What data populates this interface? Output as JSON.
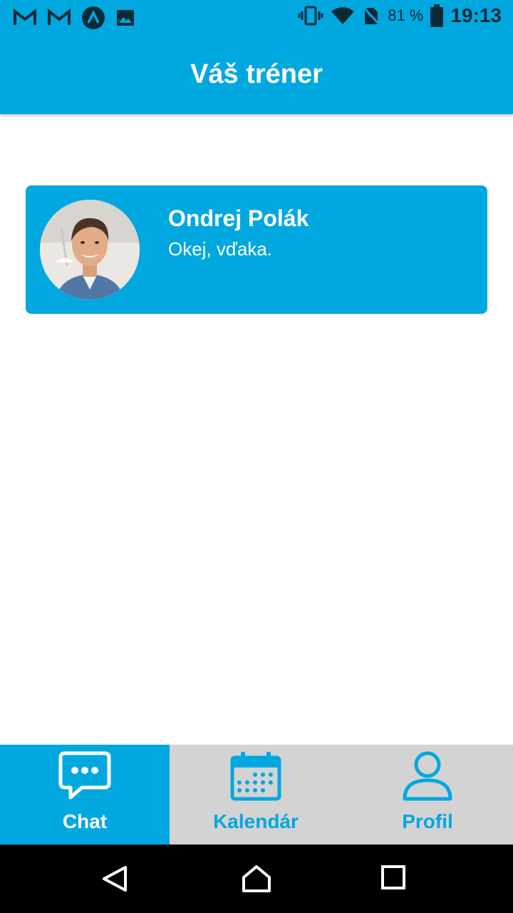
{
  "status_bar": {
    "battery_percent_text": "81 %",
    "time": "19:13",
    "icons": [
      "gmail-icon",
      "gmail-icon",
      "app-icon",
      "image-icon",
      "vibrate-icon",
      "wifi-icon",
      "no-sim-icon",
      "battery-icon"
    ]
  },
  "header": {
    "title": "Váš tréner"
  },
  "trainer_card": {
    "name": "Ondrej Polák",
    "last_message": "Okej, vďaka."
  },
  "bottom_nav": {
    "tabs": [
      {
        "label": "Chat",
        "icon": "chat-bubble-icon",
        "active": true
      },
      {
        "label": "Kalendár",
        "icon": "calendar-icon",
        "active": false
      },
      {
        "label": "Profil",
        "icon": "person-icon",
        "active": false
      }
    ]
  },
  "system_nav": {
    "icons": [
      "back-icon",
      "home-icon",
      "recents-icon"
    ]
  },
  "colors": {
    "accent": "#00a8df",
    "inactive_tab_bg": "#d3d3d3",
    "text_on_accent": "#ffffff"
  }
}
